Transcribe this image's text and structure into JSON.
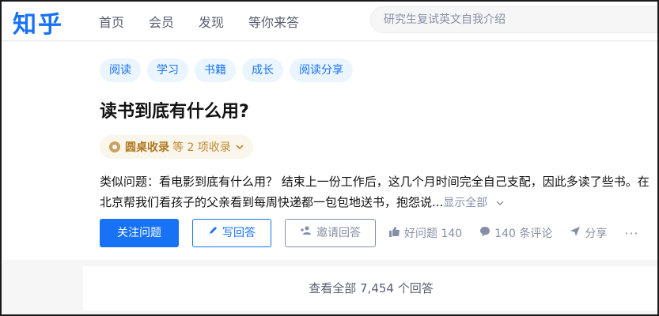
{
  "header": {
    "logo": "知乎",
    "nav": [
      "首页",
      "会员",
      "发现",
      "等你来答"
    ],
    "search_placeholder": "研究生复试英文自我介绍"
  },
  "question": {
    "tags": [
      "阅读",
      "学习",
      "书籍",
      "成长",
      "阅读分享"
    ],
    "title": "读书到底有什么用?",
    "collection": {
      "name": "圆桌收录",
      "suffix": "等 2 项收录"
    },
    "description": "类似问题：看电影到底有什么用？ 结束上一份工作后，这几个月时间完全自己支配，因此多读了些书。在北京帮我们看孩子的父亲看到每周快递都一包包地送书，抱怨说...",
    "show_all": "显示全部"
  },
  "actions": {
    "follow": "关注问题",
    "write": "写回答",
    "invite": "邀请回答",
    "good_question": "好问题 140",
    "comments": "140 条评论",
    "share": "分享",
    "more": "···"
  },
  "footer": {
    "view_all": "查看全部 7,454 个回答"
  },
  "colors": {
    "brand": "#1772f6",
    "tag_bg": "#ebf5ff",
    "collection_text": "#c08a32"
  }
}
